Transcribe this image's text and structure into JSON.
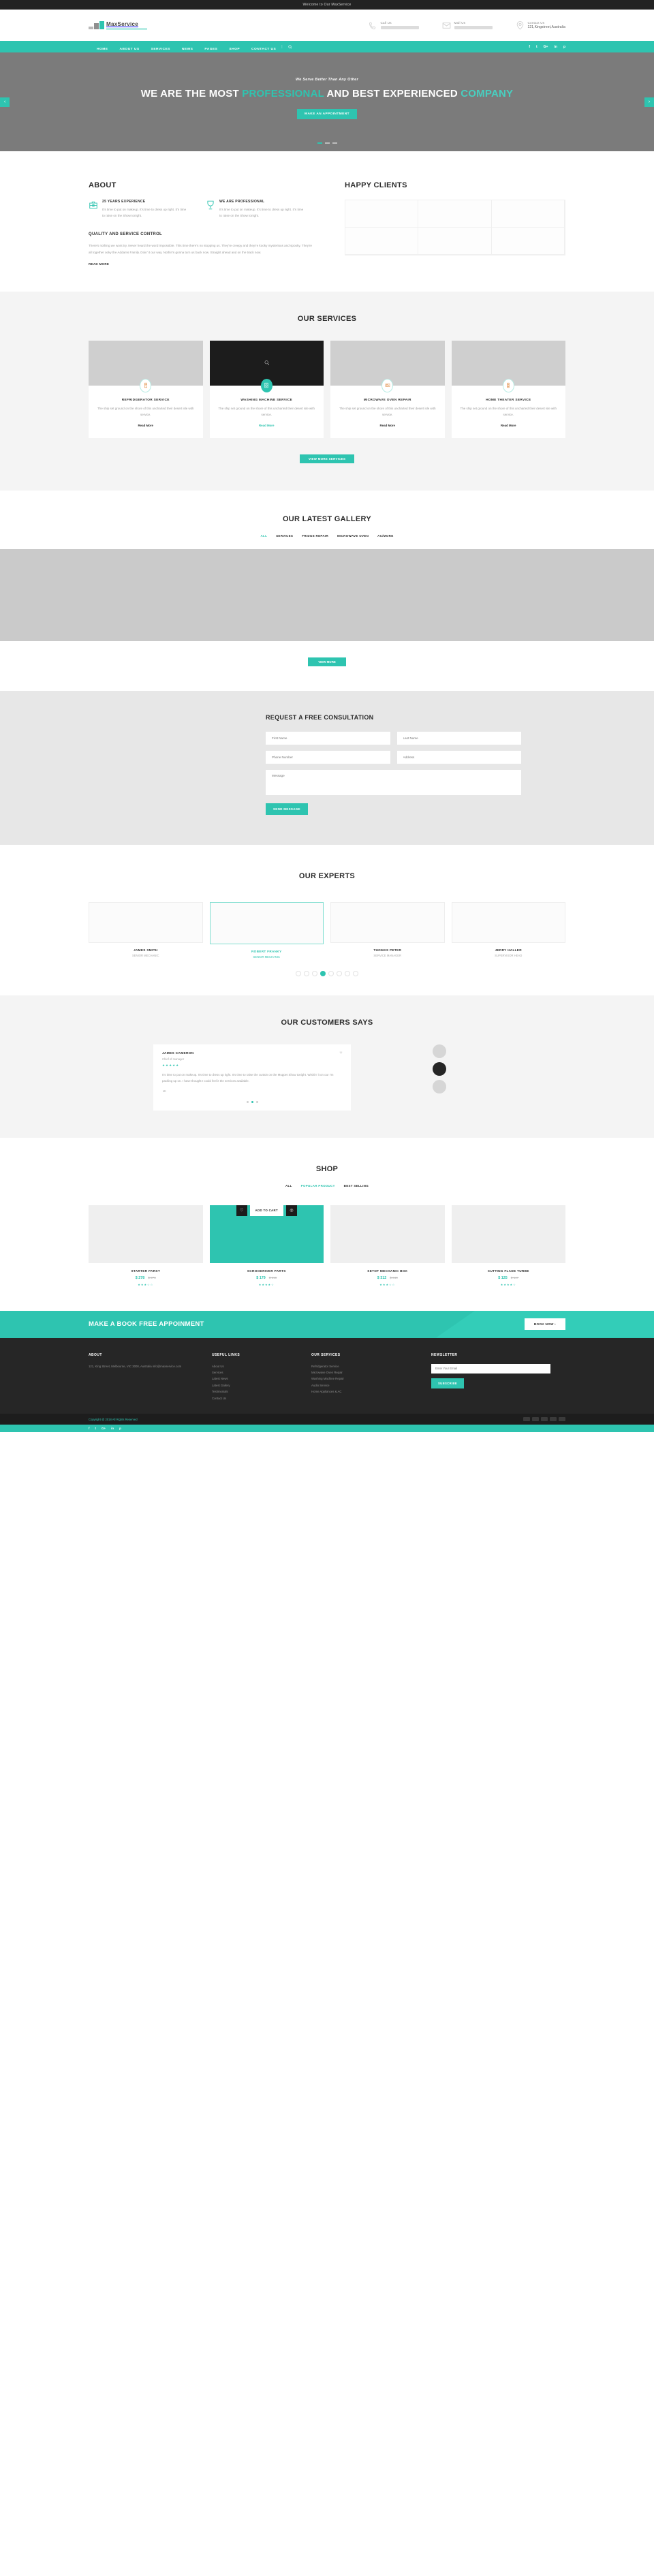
{
  "topbar": {
    "welcome": "Welcome to Our MaxService"
  },
  "header": {
    "logo_text": "MaxService",
    "contacts": [
      {
        "icon": "phone-icon",
        "label": "Call Us",
        "value": "",
        "redacted": true
      },
      {
        "icon": "mail-icon",
        "label": "Mail Us",
        "value": "",
        "redacted": true
      },
      {
        "icon": "location-icon",
        "label": "Contact Us",
        "value": "121,Kingstreet,Australia",
        "redacted": false
      }
    ]
  },
  "nav": {
    "items": [
      "HOME",
      "ABOUT US",
      "SERVICES",
      "NEWS",
      "PAGES",
      "SHOP",
      "CONTACT US"
    ],
    "search_icon": "search-icon",
    "socials": [
      "f",
      "t",
      "G+",
      "in",
      "p"
    ]
  },
  "hero": {
    "subtitle": "We Serve Better Than Any Other",
    "title_a": "WE ARE THE MOST ",
    "title_accent_a": "PROFESSIONAL",
    "title_b": " AND BEST EXPERIENCED ",
    "title_accent_b": "COMPANY",
    "cta": "MAKE AN APPOINTMENT",
    "prev": "‹",
    "next": "›"
  },
  "about": {
    "heading": "ABOUT",
    "features": [
      {
        "icon": "toolbox-icon",
        "title": "25 YEARS EXPERIENCE",
        "text": "It's time to put on makeup. It's time to dress up right. It's time to raise on the Show tonight."
      },
      {
        "icon": "trophy-icon",
        "title": "WE ARE PROFESSIONAL",
        "text": "It's time to put on makeup. It's time to dress up right. It's time to raise on the Show tonight."
      }
    ],
    "sub_heading": "QUALITY AND SERVICE CONTROL",
    "body": "There's nothing we wont try. Never heard the word impossible. This time there's no stopping us. They're creepy and they're kooky mysterious and spooky. They're all together ooky the Addams Family. Doin' it our way. Nothin's gonna turn us back now. Straight ahead and on the track now.",
    "read_more": "READ MORE",
    "clients_heading": "HAPPY CLIENTS"
  },
  "services": {
    "heading": "OUR SERVICES",
    "items": [
      {
        "icon": "refrigerator-icon",
        "title": "REFRIDGERATOR SERVICE",
        "text": "The ship set ground on the shore of this uncharted their desert isle with service.",
        "link": "Read More",
        "active": false
      },
      {
        "icon": "washing-machine-icon",
        "title": "WASHING MACHINE SERVICE",
        "text": "The ship set ground on the shore of this uncharted their desert isle with service.",
        "link": "Read More",
        "active": true
      },
      {
        "icon": "microwave-icon",
        "title": "MICROWAVE OVEN REPAIR",
        "text": "The ship set ground on the shore of this uncharted their desert isle with service.",
        "link": "Read More",
        "active": false
      },
      {
        "icon": "home-theater-icon",
        "title": "HOME THEATER SERVICE",
        "text": "The ship set ground on the shore of this uncharted their desert isle with service.",
        "link": "Read More",
        "active": false
      }
    ],
    "view_all": "VIEW MORE SERVICES"
  },
  "gallery": {
    "heading": "OUR LATEST GALLERY",
    "filters": [
      "ALL",
      "SERVICES",
      "FRIDGE REPAIR",
      "MICROWAVE OVEN",
      "AC/MORE"
    ],
    "active_filter": "ALL",
    "button": "VIEW MORE"
  },
  "consult": {
    "heading": "REQUEST A FREE CONSULTATION",
    "first_name": "First Name",
    "last_name": "Last Name",
    "phone": "Phone Number",
    "address": "Address",
    "message": "Message",
    "send": "SEND MESSAGE"
  },
  "experts": {
    "heading": "OUR EXPERTS",
    "members": [
      {
        "name": "JAMES SMITH",
        "role": "SENIOR MECHANIC",
        "selected": false
      },
      {
        "name": "ROBERT FRANKY",
        "role": "SENIOR MECHANIC",
        "selected": true
      },
      {
        "name": "THOMAS PETER",
        "role": "SERVICE MANAGER",
        "selected": false
      },
      {
        "name": "JERRY HALLER",
        "role": "SUPERVISOR HEAD",
        "selected": false
      }
    ],
    "dots": 8,
    "active_dot": 4
  },
  "testimonials": {
    "heading": "OUR CUSTOMERS SAYS",
    "name": "JAMES CAMERON",
    "role": "Chief of manager",
    "stars": "★★★★★",
    "quote": "It's time to put on makeup. It's time to dress up right. It's time to raise the curtain on the Muppet Show tonight. Wishin' it on our I'm packing up on. I have thought I could feel it the services available.",
    "signature": "✒",
    "quote_mark": "❞",
    "dots": 3,
    "active_dot": 2
  },
  "shop": {
    "heading": "SHOP",
    "filters": [
      "ALL",
      "POPULAR PRODUCT",
      "BEST SELLING"
    ],
    "active_filter": "POPULAR PRODUCT",
    "products": [
      {
        "title": "STARTER PARST",
        "price": "$ 278",
        "old_price": "$ 278",
        "stars": "★★★☆☆",
        "hot": false
      },
      {
        "title": "SCROODRIVER PARTS",
        "price": "$ 179",
        "old_price": "$ 219",
        "stars": "★★★★☆",
        "hot": true,
        "cart": "ADD TO CART",
        "wish_icon": "heart-icon",
        "compare_icon": "compare-icon"
      },
      {
        "title": "SETOF MECHANIC BOX",
        "price": "$ 312",
        "old_price": "$ 340",
        "stars": "★★★☆☆",
        "hot": false
      },
      {
        "title": "CUTTING FLADE TURBE",
        "price": "$ 125",
        "old_price": "$ 147",
        "stars": "★★★★☆",
        "hot": false
      }
    ]
  },
  "cta": {
    "title": "MAKE A BOOK FREE APPOINMENT",
    "button": "BOOK NOW  ›"
  },
  "footer": {
    "about": {
      "title": "ABOUT",
      "text": "121, King Street, Melbourne, VIC 3000, Australia info@maxservice.com"
    },
    "useful": {
      "title": "USEFUL LINKS",
      "links": [
        "About Us",
        "Services",
        "Latest News",
        "Latest Gallery",
        "Testimonials",
        "Contact Us"
      ]
    },
    "our_services": {
      "title": "OUR SERVICES",
      "links": [
        "Refridgerator Service",
        "Microwave Oven Repair",
        "Washing Machine Repair",
        "Audio Service",
        "Home Appliances & AC"
      ]
    },
    "newsletter": {
      "title": "NEWSLETTER",
      "placeholder": "Enter Your Email",
      "button": "SUBSCRIBE"
    },
    "copyright": "Copyright @ 2018 All Rights Reserved",
    "socials": [
      "f",
      "t",
      "G+",
      "in",
      "p"
    ]
  }
}
